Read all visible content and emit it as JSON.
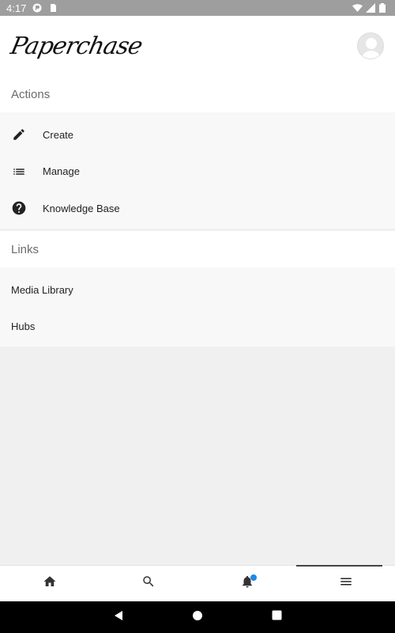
{
  "status_bar": {
    "time": "4:17"
  },
  "header": {
    "logo_text": "Paperchase"
  },
  "sections": {
    "actions": {
      "title": "Actions",
      "items": [
        {
          "label": "Create",
          "icon": "pencil-icon"
        },
        {
          "label": "Manage",
          "icon": "list-icon"
        },
        {
          "label": "Knowledge Base",
          "icon": "help-circle-icon"
        }
      ]
    },
    "links": {
      "title": "Links",
      "items": [
        {
          "label": "Media Library"
        },
        {
          "label": "Hubs"
        }
      ]
    }
  },
  "bottom_nav": {
    "items": [
      "home-icon",
      "search-icon",
      "bell-icon",
      "menu-icon"
    ],
    "active": "menu-icon",
    "notification_color": "#1e88e5"
  }
}
